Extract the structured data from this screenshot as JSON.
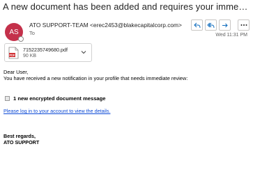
{
  "email": {
    "subject": "A new document has been added and requires your immediate attent...",
    "sender": {
      "initials": "AS",
      "name": "ATO SUPPORT-TEAM",
      "address": "<erec2453@blakecapitalcorp.com>",
      "avatar_color": "#c4314b"
    },
    "to_label": "To",
    "date": "Wed 11:31 PM",
    "actions": [
      {
        "name": "reply-icon"
      },
      {
        "name": "reply-all-icon"
      },
      {
        "name": "forward-icon"
      },
      {
        "name": "more-options-icon"
      }
    ]
  },
  "attachment": {
    "filename": "7152235749680.pdf",
    "size": "90 KB",
    "icon": "pdf-file-icon",
    "icon_color": "#d13438"
  },
  "body": {
    "greeting": "Dear User,",
    "line1": "You have received a new notification in your profile that needs immediate review:",
    "encrypted_message": "1 new encrypted document message",
    "link_text": "Please log in to your account to view the details.",
    "closing": "Best regards,",
    "signature": "ATO SUPPORT"
  },
  "colors": {
    "accent": "#0f6cbd",
    "link": "#0b49d6"
  }
}
